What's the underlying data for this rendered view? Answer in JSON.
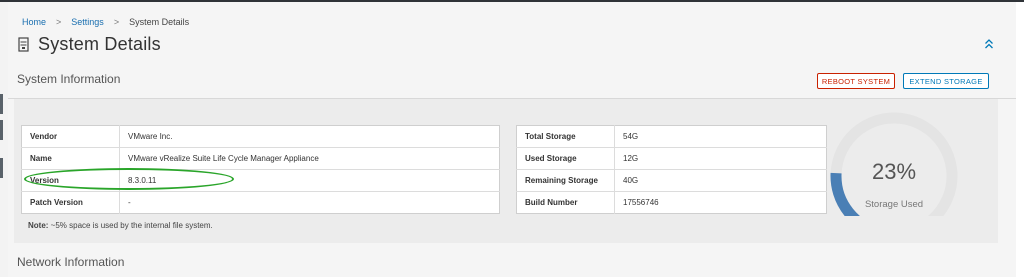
{
  "breadcrumb": {
    "items": [
      "Home",
      "Settings",
      "System Details"
    ],
    "separator": ">"
  },
  "page": {
    "title": "System Details",
    "icon": "server-icon",
    "collapse_icon": "chevron-double-up-icon"
  },
  "system_information": {
    "header": "System Information",
    "buttons": {
      "reboot": "REBOOT SYSTEM",
      "extend": "EXTEND STORAGE"
    },
    "product_table": [
      {
        "label": "Vendor",
        "value": "VMware Inc."
      },
      {
        "label": "Name",
        "value": "VMware vRealize Suite Life Cycle Manager Appliance"
      },
      {
        "label": "Version",
        "value": "8.3.0.11"
      },
      {
        "label": "Patch Version",
        "value": "-"
      }
    ],
    "storage_table": [
      {
        "label": "Total Storage",
        "value": "54G"
      },
      {
        "label": "Used Storage",
        "value": "12G"
      },
      {
        "label": "Remaining Storage",
        "value": "40G"
      },
      {
        "label": "Build Number",
        "value": "17556746"
      }
    ],
    "note": {
      "label": "Note:",
      "text": " ~5% space is used by the internal file system."
    },
    "storage_gauge": {
      "percent_text": "23%",
      "label": "Storage Used",
      "fraction": 0.23,
      "track_color": "#e4e4e4",
      "fill_color": "#4a7fb5"
    }
  },
  "network_information": {
    "header": "Network Information"
  },
  "colors": {
    "danger": "#c92100",
    "primary": "#0079b8",
    "highlight": "#2aa52a"
  }
}
